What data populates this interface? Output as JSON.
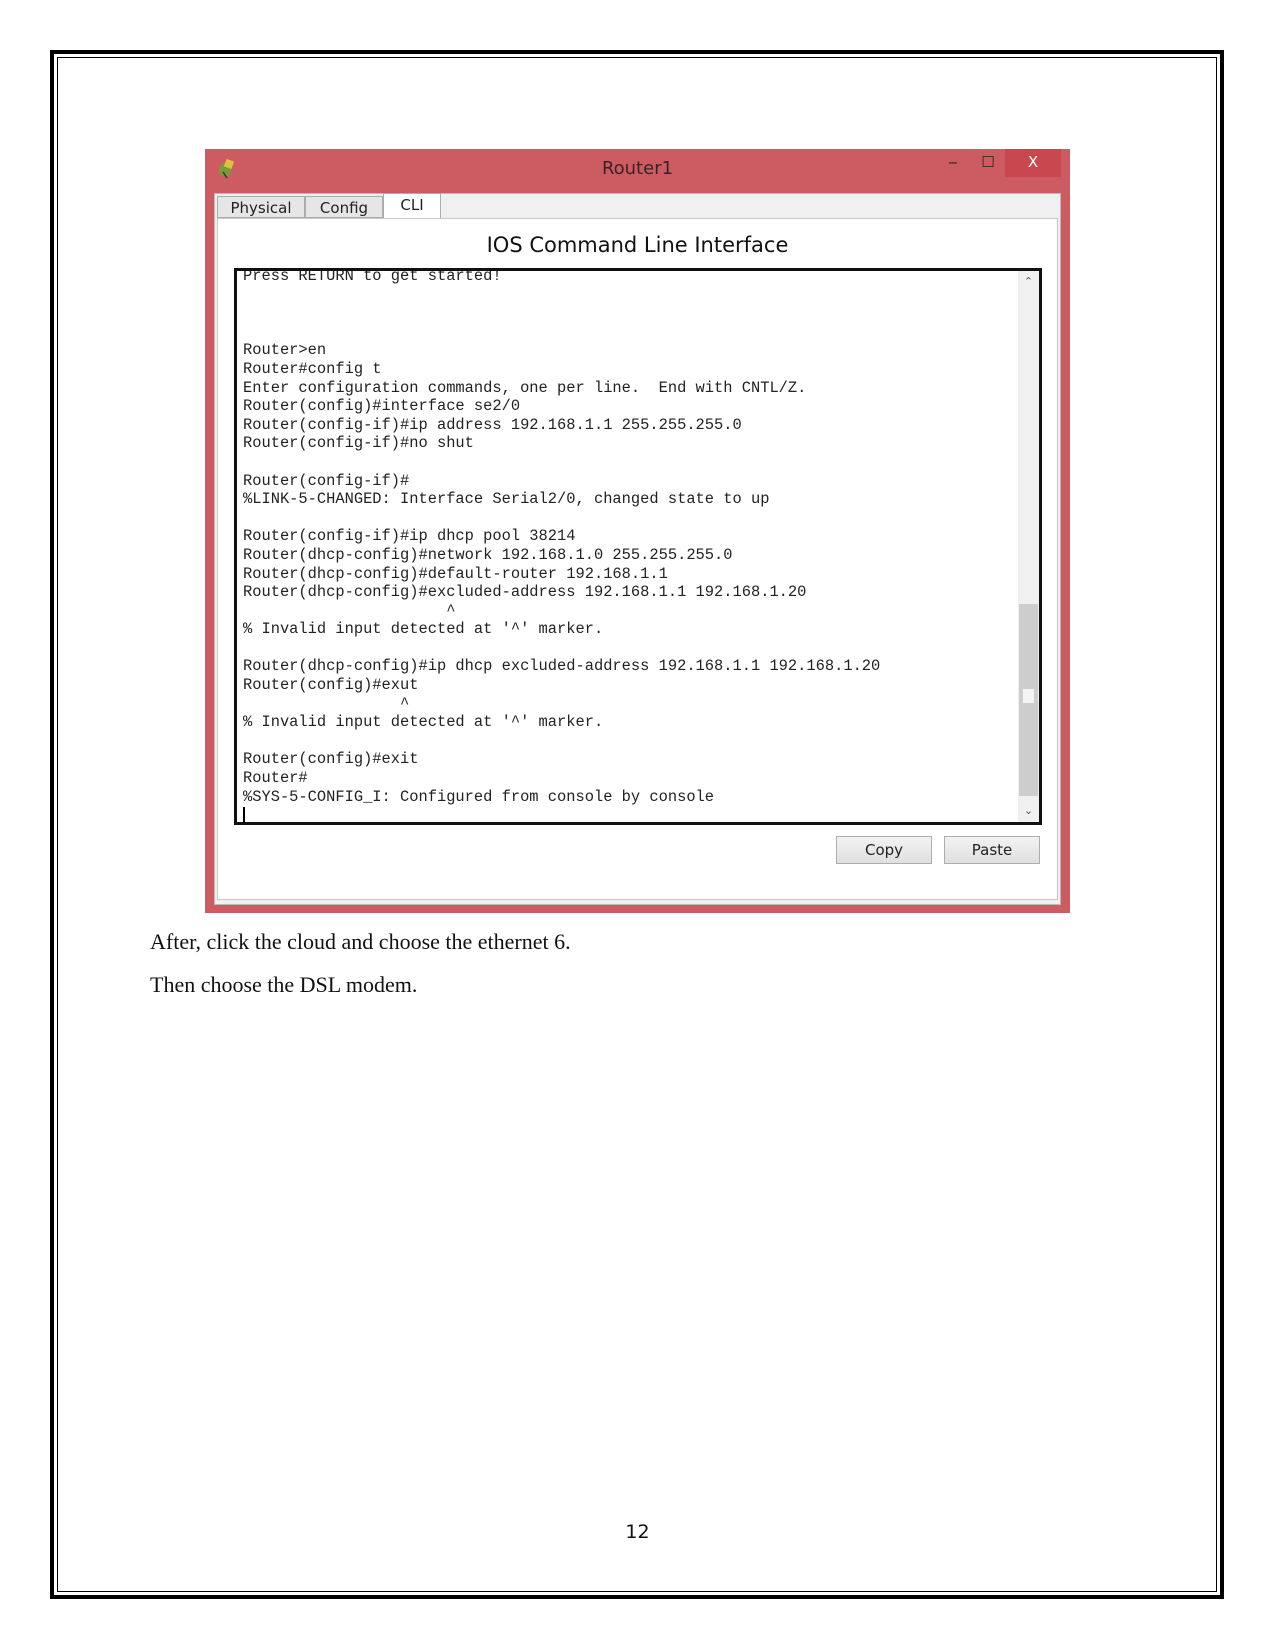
{
  "window": {
    "title": "Router1",
    "controls": {
      "minimize": "‒",
      "maximize": "☐",
      "close": "X"
    },
    "tabs": [
      {
        "label": "Physical"
      },
      {
        "label": "Config"
      },
      {
        "label": "CLI",
        "active": true
      }
    ],
    "heading": "IOS Command Line Interface",
    "terminal_lines": [
      "Press RETURN to get started!",
      "",
      "",
      "",
      "Router>en",
      "Router#config t",
      "Enter configuration commands, one per line.  End with CNTL/Z.",
      "Router(config)#interface se2/0",
      "Router(config-if)#ip address 192.168.1.1 255.255.255.0",
      "Router(config-if)#no shut",
      "",
      "Router(config-if)#",
      "%LINK-5-CHANGED: Interface Serial2/0, changed state to up",
      "",
      "Router(config-if)#ip dhcp pool 38214",
      "Router(dhcp-config)#network 192.168.1.0 255.255.255.0",
      "Router(dhcp-config)#default-router 192.168.1.1",
      "Router(dhcp-config)#excluded-address 192.168.1.1 192.168.1.20",
      "                      ^",
      "% Invalid input detected at '^' marker.",
      "",
      "Router(dhcp-config)#ip dhcp excluded-address 192.168.1.1 192.168.1.20",
      "Router(config)#exut",
      "                 ^",
      "% Invalid input detected at '^' marker.",
      "",
      "Router(config)#exit",
      "Router#",
      "%SYS-5-CONFIG_I: Configured from console by console"
    ],
    "scroll_up": "⌃",
    "scroll_down": "⌄",
    "copy_label": "Copy",
    "paste_label": "Paste",
    "accent_color": "#cd5b62"
  },
  "paragraphs": [
    "After, click the cloud and choose the ethernet 6.",
    "Then choose the DSL modem."
  ],
  "page_number": "12"
}
